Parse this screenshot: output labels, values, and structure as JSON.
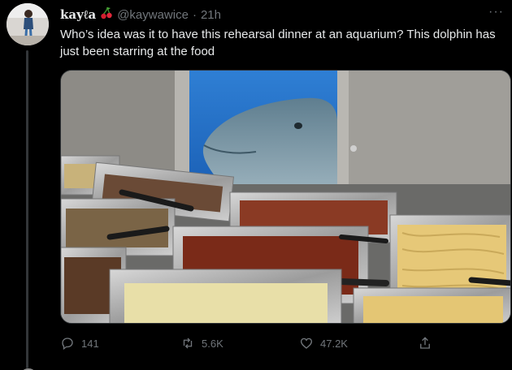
{
  "tweet": {
    "display_name": "kayℓa",
    "name_emoji": "cherries-icon",
    "handle": "@kaywawice",
    "separator": "·",
    "time": "21h",
    "more": "···",
    "text": "Who’s idea was it to have this rehearsal dinner at an aquarium? This dolphin has just been starring at the food"
  },
  "actions": {
    "reply_count": "141",
    "retweet_count": "5.6K",
    "like_count": "47.2K"
  },
  "colors": {
    "background": "#000000",
    "text": "#e7e9ea",
    "muted": "#71767b",
    "thread_line": "#333639"
  }
}
